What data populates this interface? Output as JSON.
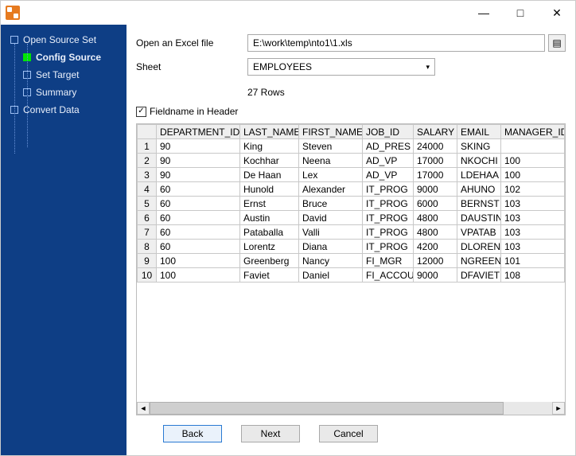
{
  "window": {
    "title": ""
  },
  "sidebar": {
    "items": [
      {
        "label": "Open Source Set",
        "active": false
      },
      {
        "label": "Config Source",
        "active": true
      },
      {
        "label": "Set Target",
        "active": false
      },
      {
        "label": "Summary",
        "active": false
      },
      {
        "label": "Convert Data",
        "active": false
      }
    ]
  },
  "form": {
    "open_file_label": "Open an Excel file",
    "file_path": "E:\\work\\temp\\nto1\\1.xls",
    "sheet_label": "Sheet",
    "sheet_value": "EMPLOYEES",
    "rows_count": "27 Rows",
    "fieldname_checkbox_label": "Fieldname in Header",
    "fieldname_checked": true
  },
  "table": {
    "columns": [
      "DEPARTMENT_ID",
      "LAST_NAME",
      "FIRST_NAME",
      "JOB_ID",
      "SALARY",
      "EMAIL",
      "MANAGER_ID"
    ],
    "rows": [
      {
        "n": "1",
        "dept": "90",
        "last": "King",
        "first": "Steven",
        "job": "AD_PRES",
        "salary": "24000",
        "email": "SKING",
        "mgr": ""
      },
      {
        "n": "2",
        "dept": "90",
        "last": "Kochhar",
        "first": "Neena",
        "job": "AD_VP",
        "salary": "17000",
        "email": "NKOCHI",
        "mgr": "100"
      },
      {
        "n": "3",
        "dept": "90",
        "last": "De Haan",
        "first": "Lex",
        "job": "AD_VP",
        "salary": "17000",
        "email": "LDEHAA",
        "mgr": "100"
      },
      {
        "n": "4",
        "dept": "60",
        "last": "Hunold",
        "first": "Alexander",
        "job": "IT_PROG",
        "salary": "9000",
        "email": "AHUNO",
        "mgr": "102"
      },
      {
        "n": "5",
        "dept": "60",
        "last": "Ernst",
        "first": "Bruce",
        "job": "IT_PROG",
        "salary": "6000",
        "email": "BERNST",
        "mgr": "103"
      },
      {
        "n": "6",
        "dept": "60",
        "last": "Austin",
        "first": "David",
        "job": "IT_PROG",
        "salary": "4800",
        "email": "DAUSTIN",
        "mgr": "103"
      },
      {
        "n": "7",
        "dept": "60",
        "last": "Pataballa",
        "first": "Valli",
        "job": "IT_PROG",
        "salary": "4800",
        "email": "VPATAB",
        "mgr": "103"
      },
      {
        "n": "8",
        "dept": "60",
        "last": "Lorentz",
        "first": "Diana",
        "job": "IT_PROG",
        "salary": "4200",
        "email": "DLOREN",
        "mgr": "103"
      },
      {
        "n": "9",
        "dept": "100",
        "last": "Greenberg",
        "first": "Nancy",
        "job": "FI_MGR",
        "salary": "12000",
        "email": "NGREEN",
        "mgr": "101"
      },
      {
        "n": "10",
        "dept": "100",
        "last": "Faviet",
        "first": "Daniel",
        "job": "FI_ACCOU",
        "salary": "9000",
        "email": "DFAVIET",
        "mgr": "108"
      }
    ]
  },
  "footer": {
    "back": "Back",
    "next": "Next",
    "cancel": "Cancel"
  },
  "icons": {
    "checkmark": "✓",
    "caret_down": "▾",
    "browse": "▤",
    "scroll_left": "◄",
    "scroll_right": "►",
    "min": "—",
    "max": "□",
    "close": "✕"
  }
}
